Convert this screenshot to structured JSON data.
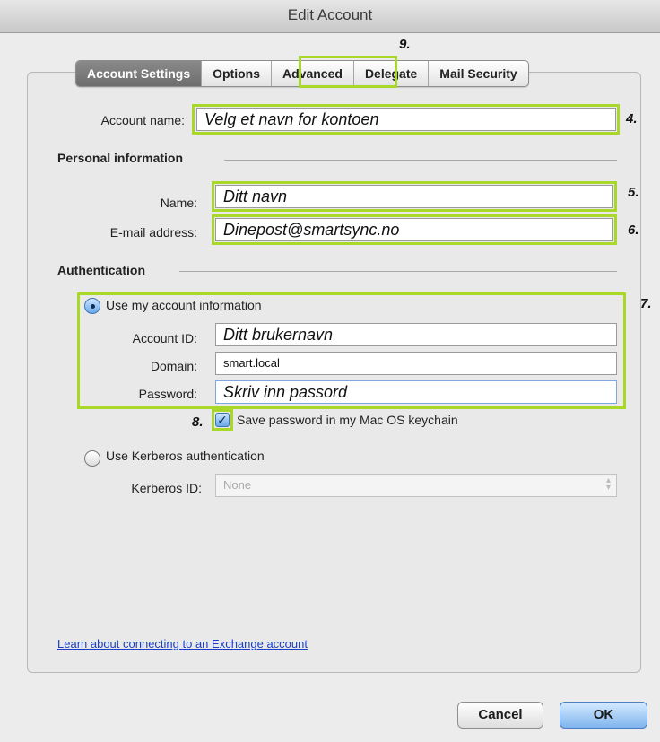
{
  "window": {
    "title": "Edit Account"
  },
  "tabs": [
    {
      "label": "Account Settings",
      "active": true
    },
    {
      "label": "Options"
    },
    {
      "label": "Advanced"
    },
    {
      "label": "Delegate"
    },
    {
      "label": "Mail Security"
    }
  ],
  "account": {
    "label": "Account name:",
    "value": "Velg et navn for kontoen"
  },
  "personal": {
    "heading": "Personal information",
    "name_label": "Name:",
    "name_value": "Ditt navn",
    "email_label": "E-mail address:",
    "email_value": "Dinepost@smartsync.no"
  },
  "auth": {
    "heading": "Authentication",
    "use_my_info": "Use my account information",
    "account_id_label": "Account ID:",
    "account_id_value": "Ditt brukernavn",
    "domain_label": "Domain:",
    "domain_value": "smart.local",
    "password_label": "Password:",
    "password_value": "Skriv inn passord",
    "save_password": "Save password in my Mac OS keychain",
    "use_kerberos": "Use Kerberos authentication",
    "kerberos_label": "Kerberos ID:",
    "kerberos_value": "None"
  },
  "link": "Learn about connecting to an Exchange account",
  "buttons": {
    "cancel": "Cancel",
    "ok": "OK"
  },
  "annotations": {
    "n4": "4.",
    "n5": "5.",
    "n6": "6.",
    "n7": "7.",
    "n8": "8.",
    "n9": "9."
  },
  "highlight_color": "#a9d82a"
}
